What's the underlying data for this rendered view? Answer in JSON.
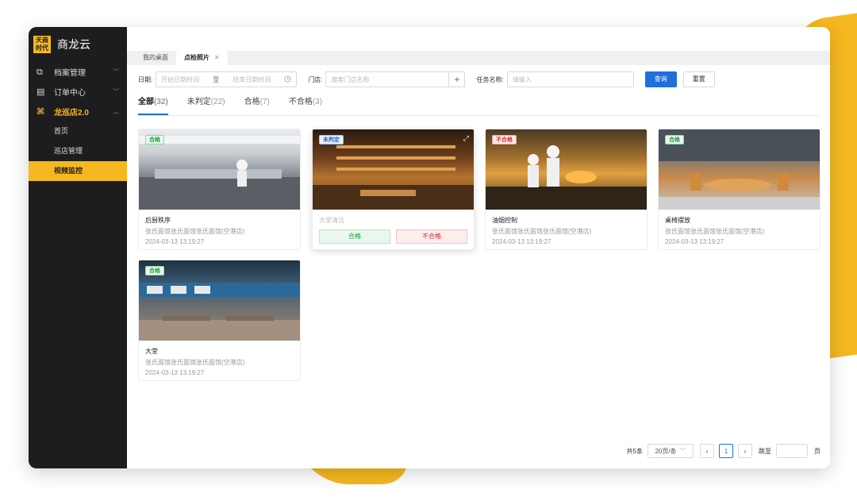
{
  "logo": {
    "mark_line1": "天商",
    "mark_line2": "时代",
    "name": "商龙云"
  },
  "sidebar": {
    "groups": [
      {
        "icon": "⧉",
        "label": "档案管理",
        "arrow": "﹀"
      },
      {
        "icon": "▤",
        "label": "订单中心",
        "arrow": "﹀"
      },
      {
        "icon": "⌘",
        "label": "龙巡店2.0",
        "arrow": "︿"
      }
    ],
    "sub_items": [
      "首页",
      "巡店管理",
      "视频监控"
    ]
  },
  "tabs": [
    {
      "label": "我的桌面"
    },
    {
      "label": "点检照片",
      "close": "✕"
    }
  ],
  "filters": {
    "date_label": "日期:",
    "date_start_placeholder": "开始日期时间",
    "date_separator": "至",
    "date_end_placeholder": "结束日期时间",
    "store_label": "门店:",
    "store_placeholder": "搜索门店名称",
    "plus": "+",
    "task_label": "任务名称:",
    "task_placeholder": "请输入",
    "query_button": "查询",
    "reset_button": "重置"
  },
  "status_tabs": [
    {
      "label": "全部",
      "count": "(32)"
    },
    {
      "label": "未判定",
      "count": "(22)"
    },
    {
      "label": "合格",
      "count": "(7)"
    },
    {
      "label": "不合格",
      "count": "(3)"
    }
  ],
  "cards": [
    {
      "badge": "合格",
      "title": "后厨秩序",
      "store": "张氏面馆张氏面馆张氏面馆(空港店)",
      "time": "2024-03-13 13:19:27"
    },
    {
      "badge": "未判定",
      "title": "大堂清洁",
      "pass_label": "合格",
      "fail_label": "不合格"
    },
    {
      "badge": "不合格",
      "title": "油烟控制",
      "store": "张氏面馆张氏面馆张氏面馆(空港店)",
      "time": "2024-03-13 13:19:27"
    },
    {
      "badge": "合格",
      "title": "桌椅摆放",
      "store": "张氏面馆张氏面馆张氏面馆(空港店)",
      "time": "2024-03-13 13:19:27"
    },
    {
      "badge": "合格",
      "title": "大堂",
      "store": "张氏面馆张氏面馆张氏面馆(空港店)",
      "time": "2024-03-13 13:19:27"
    }
  ],
  "pager": {
    "total": "共5条",
    "page_size": "20页/条",
    "prev": "‹",
    "current": "1",
    "next": "›",
    "goto_label": "跳至",
    "page_suffix": "页"
  },
  "colors": {
    "accent": "#f5b820",
    "primary": "#1f6fdc",
    "pass": "#1a9d3b",
    "fail": "#d42a2a"
  }
}
